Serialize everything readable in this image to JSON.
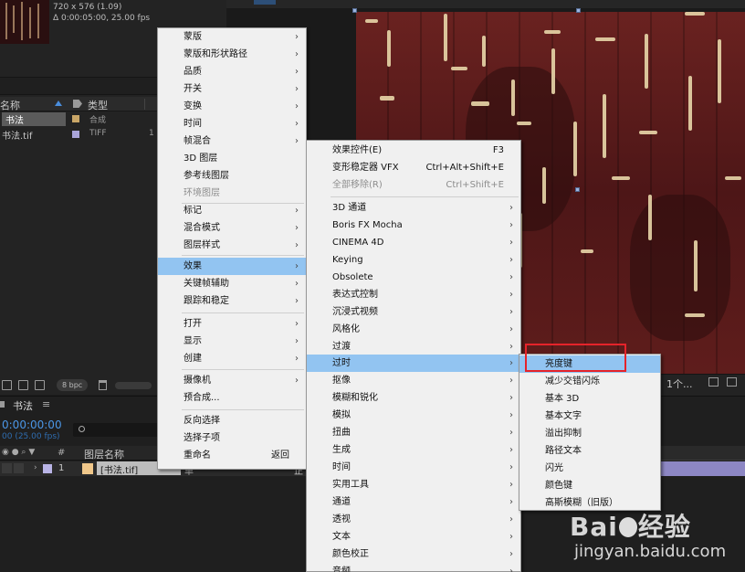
{
  "project": {
    "resolution": "720 x 576 (1.09)",
    "duration": "Δ 0:00:05:00, 25.00 fps",
    "columns": {
      "name": "名称",
      "type": "类型"
    },
    "rows": [
      {
        "name": "书法",
        "type": "合成",
        "size": "",
        "color": "#c9a667"
      },
      {
        "name": "书法.tif",
        "type": "TIFF",
        "size": "1",
        "color": "#a9a4d9"
      }
    ],
    "bpc": "8 bpc"
  },
  "viewer": {
    "view_select": "1个..."
  },
  "timeline": {
    "tab_label": "书法",
    "tab_menu": "≡",
    "timecode": "0:00:00:00",
    "fps": "00 (25.00 fps)",
    "col_layer_name": "图层名称",
    "col_hash": "#",
    "layer": {
      "number": "1",
      "name": "[书法.tif]",
      "mode": "单",
      "parent": "正"
    }
  },
  "main_menu": {
    "items": [
      {
        "label": "蒙版",
        "submenu": true
      },
      {
        "label": "蒙版和形状路径",
        "submenu": true
      },
      {
        "label": "品质",
        "submenu": true
      },
      {
        "label": "开关",
        "submenu": true
      },
      {
        "label": "变换",
        "submenu": true
      },
      {
        "label": "时间",
        "submenu": true
      },
      {
        "label": "帧混合",
        "submenu": true
      },
      {
        "label": "3D 图层",
        "submenu": false
      },
      {
        "label": "参考线图层",
        "submenu": false
      },
      {
        "label": "环境图层",
        "submenu": false,
        "disabled": true
      },
      {
        "label": "标记",
        "submenu": true
      },
      {
        "label": "混合模式",
        "submenu": true
      },
      {
        "label": "图层样式",
        "submenu": true
      },
      {
        "label": "效果",
        "submenu": true,
        "highlighted": true
      },
      {
        "label": "关键帧辅助",
        "submenu": true
      },
      {
        "label": "跟踪和稳定",
        "submenu": true
      },
      {
        "label": "打开",
        "submenu": true
      },
      {
        "label": "显示",
        "submenu": true
      },
      {
        "label": "创建",
        "submenu": true
      },
      {
        "label": "摄像机",
        "submenu": true
      },
      {
        "label": "预合成...",
        "submenu": false
      },
      {
        "label": "反向选择",
        "submenu": false
      },
      {
        "label": "选择子项",
        "submenu": false
      },
      {
        "label": "重命名",
        "submenu": false,
        "shortcut": "返回"
      }
    ]
  },
  "effect_menu": {
    "items": [
      {
        "label": "效果控件(E)",
        "shortcut": "F3"
      },
      {
        "label": "变形稳定器 VFX",
        "shortcut": "Ctrl+Alt+Shift+E"
      },
      {
        "label": "全部移除(R)",
        "shortcut": "Ctrl+Shift+E",
        "disabled": true
      },
      {
        "label": "3D 通道",
        "submenu": true
      },
      {
        "label": "Boris FX Mocha",
        "submenu": true
      },
      {
        "label": "CINEMA 4D",
        "submenu": true
      },
      {
        "label": "Keying",
        "submenu": true
      },
      {
        "label": "Obsolete",
        "submenu": true
      },
      {
        "label": "表达式控制",
        "submenu": true
      },
      {
        "label": "沉浸式视频",
        "submenu": true
      },
      {
        "label": "风格化",
        "submenu": true
      },
      {
        "label": "过渡",
        "submenu": true
      },
      {
        "label": "过时",
        "submenu": true,
        "highlighted": true
      },
      {
        "label": "抠像",
        "submenu": true
      },
      {
        "label": "模糊和锐化",
        "submenu": true
      },
      {
        "label": "模拟",
        "submenu": true
      },
      {
        "label": "扭曲",
        "submenu": true
      },
      {
        "label": "生成",
        "submenu": true
      },
      {
        "label": "时间",
        "submenu": true
      },
      {
        "label": "实用工具",
        "submenu": true
      },
      {
        "label": "通道",
        "submenu": true
      },
      {
        "label": "透视",
        "submenu": true
      },
      {
        "label": "文本",
        "submenu": true
      },
      {
        "label": "颜色校正",
        "submenu": true
      },
      {
        "label": "音频",
        "submenu": true
      }
    ]
  },
  "obsolete_menu": {
    "items": [
      {
        "label": "亮度键",
        "highlighted": true
      },
      {
        "label": "减少交错闪烁"
      },
      {
        "label": "基本 3D"
      },
      {
        "label": "基本文字"
      },
      {
        "label": "溢出抑制"
      },
      {
        "label": "路径文本"
      },
      {
        "label": "闪光"
      },
      {
        "label": "颜色键"
      },
      {
        "label": "高斯模糊（旧版）"
      }
    ]
  },
  "watermark": {
    "logo_a": "Bai",
    "logo_b": "经验",
    "url": "jingyan.baidu.com"
  },
  "colors": {
    "highlight": "#92c4f1",
    "annotation": "#e5232a",
    "timecode": "#4b96e6"
  },
  "icons": {
    "submenu_arrow": "chevron-right-icon",
    "sort": "sort-arrow-icon",
    "label": "label-tag-icon"
  }
}
